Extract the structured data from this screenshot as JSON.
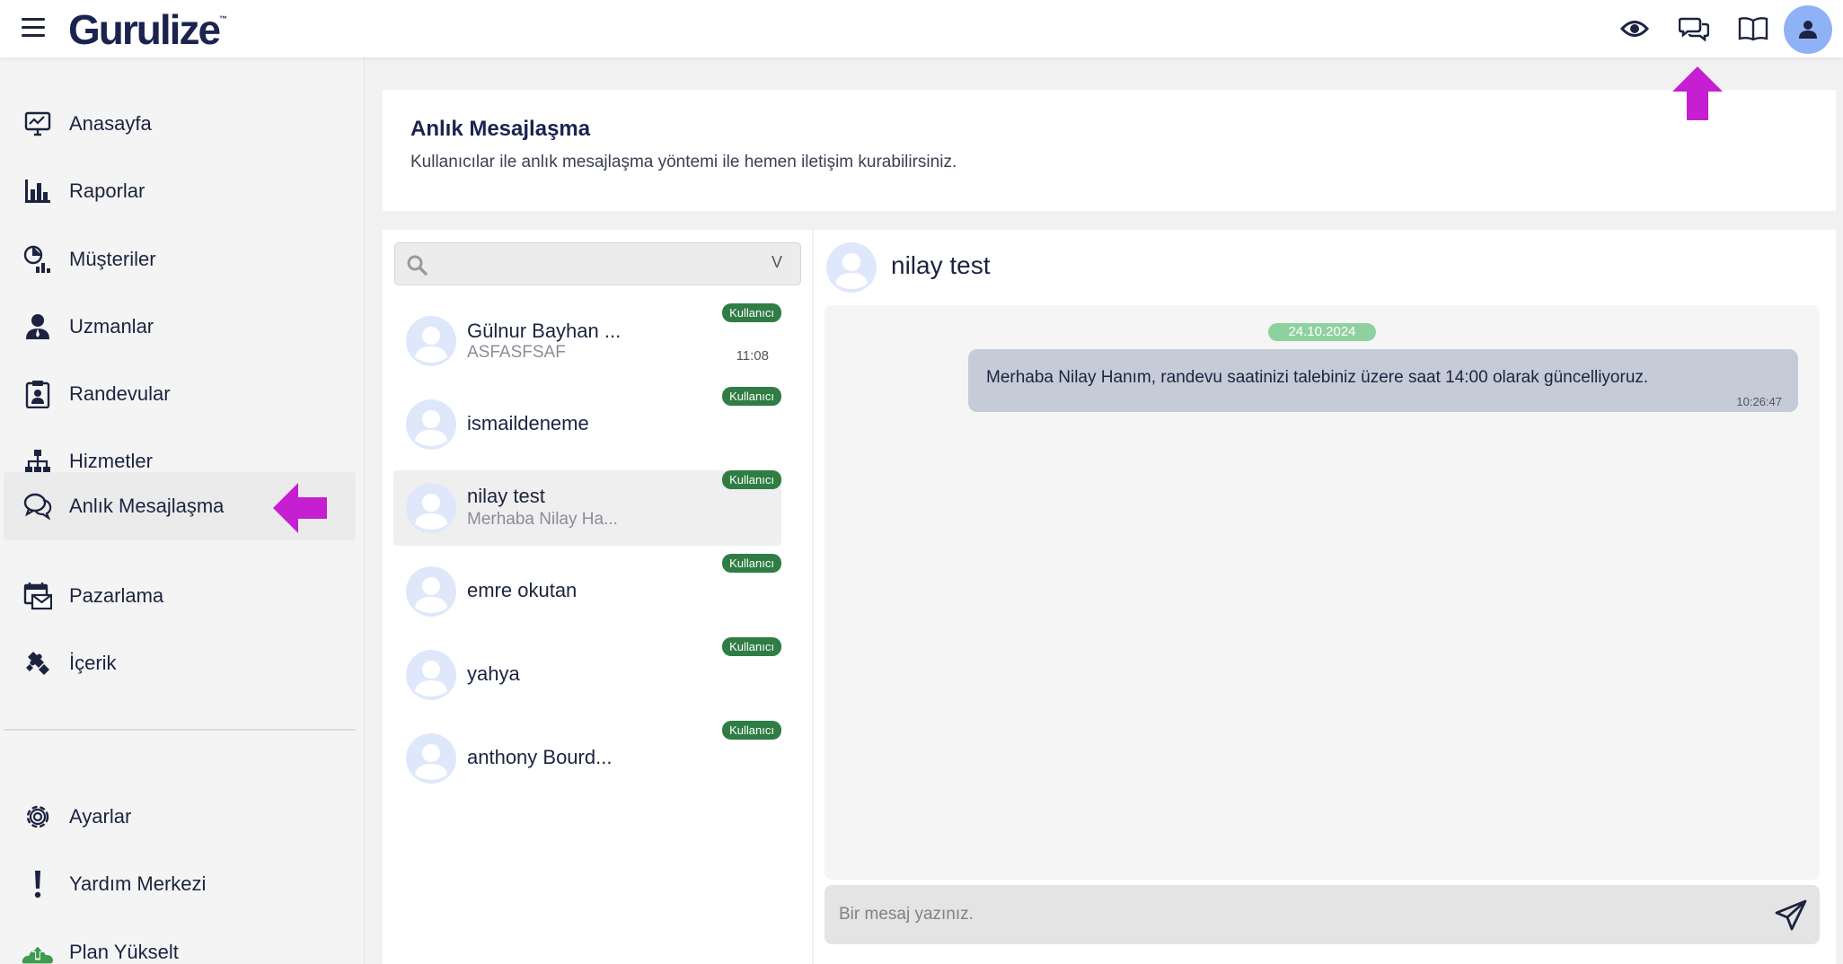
{
  "app": {
    "logo": "Gurulize",
    "logo_mark": "™"
  },
  "topbar": {
    "icons": [
      "eye-icon",
      "chat-bubbles-icon",
      "book-icon",
      "user-icon"
    ]
  },
  "sidebar": {
    "items": [
      {
        "label": "Anasayfa",
        "icon": "monitor-icon"
      },
      {
        "label": "Raporlar",
        "icon": "bar-chart-icon"
      },
      {
        "label": "Müşteriler",
        "icon": "customers-icon"
      },
      {
        "label": "Uzmanlar",
        "icon": "expert-icon"
      },
      {
        "label": "Randevular",
        "icon": "clipboard-icon"
      },
      {
        "label": "Hizmetler",
        "icon": "hierarchy-icon"
      },
      {
        "label": "Anlık Mesajlaşma",
        "icon": "chat-icon",
        "active": true
      },
      {
        "label": "Pazarlama",
        "icon": "calendar-mail-icon"
      },
      {
        "label": "İçerik",
        "icon": "puzzle-icon"
      }
    ],
    "bottom_items": [
      {
        "label": "Ayarlar",
        "icon": "gear-icon"
      },
      {
        "label": "Yardım Merkezi",
        "icon": "exclamation-icon"
      },
      {
        "label": "Plan Yükselt",
        "icon": "upgrade-icon"
      }
    ]
  },
  "header": {
    "title": "Anlık Mesajlaşma",
    "description": "Kullanıcılar ile anlık mesajlaşma yöntemi ile hemen iletişim kurabilirsiniz."
  },
  "search": {
    "placeholder": "",
    "chevron": "V"
  },
  "conversations": [
    {
      "name": "Gülnur Bayhan ...",
      "preview": "ASFASFSAF",
      "badge": "Kullanıcı",
      "time": "11:08"
    },
    {
      "name": "ismaildeneme",
      "preview": "",
      "badge": "Kullanıcı",
      "time": ""
    },
    {
      "name": "nilay test",
      "preview": "Merhaba Nilay Ha...",
      "badge": "Kullanıcı",
      "time": "",
      "selected": true
    },
    {
      "name": "emre okutan",
      "preview": "",
      "badge": "Kullanıcı",
      "time": ""
    },
    {
      "name": "yahya",
      "preview": "",
      "badge": "Kullanıcı",
      "time": ""
    },
    {
      "name": "anthony Bourd...",
      "preview": "",
      "badge": "Kullanıcı",
      "time": ""
    }
  ],
  "chat": {
    "contact_name": "nilay test",
    "date": "24.10.2024",
    "messages": [
      {
        "text": "Merhaba Nilay Hanım, randevu saatinizi talebiniz üzere saat 14:00 olarak güncelliyoruz.",
        "time": "10:26:47",
        "outgoing": true
      }
    ],
    "composer_placeholder": "Bir mesaj yazınız."
  },
  "colors": {
    "brand": "#1b2450",
    "badge": "#2f7d45",
    "date_pill": "#8fd19e",
    "bubble": "#c5ccd8",
    "avatar_bg": "#dfe8fb",
    "top_avatar": "#8fb2f7",
    "annotation_arrow": "#c51fd1"
  }
}
